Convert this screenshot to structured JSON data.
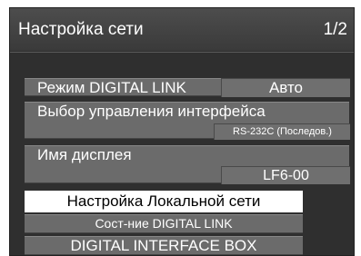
{
  "header": {
    "title": "Настройка сети",
    "page": "1/2"
  },
  "items": {
    "digital_link_mode": {
      "label": "Режим DIGITAL LINK",
      "value": "Авто"
    },
    "interface_control": {
      "label": "Выбор управления интерфейса",
      "value": "RS-232C (Последов.)"
    },
    "display_name": {
      "label": "Имя дисплея",
      "value": "LF6-00"
    },
    "lan_setup": {
      "label": "Настройка Локальной сети"
    },
    "digital_link_status": {
      "label": "Сост-ние DIGITAL LINK"
    },
    "digital_interface_box": {
      "label": "DIGITAL INTERFACE BOX"
    }
  }
}
